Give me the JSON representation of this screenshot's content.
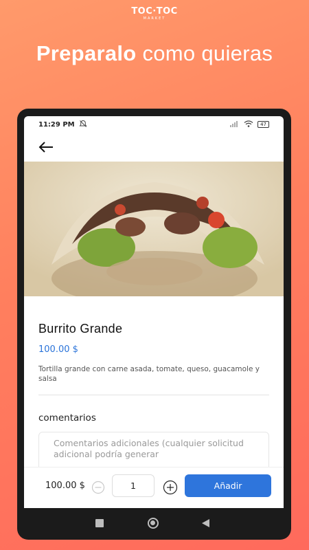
{
  "brand": {
    "name": "TOC·TOC",
    "sub": "MARKET"
  },
  "headline": {
    "bold": "Preparalo",
    "rest": "como quieras"
  },
  "status": {
    "time": "11:29 PM",
    "battery": "47"
  },
  "product": {
    "title": "Burrito Grande",
    "price": "100.00 $",
    "description": "Tortilla grande con carne asada, tomate, queso, guacamole y salsa"
  },
  "comments": {
    "label": "comentarios",
    "placeholder": "Comentarios adicionales (cualquier solicitud adicional podría generar"
  },
  "cart": {
    "total": "100.00 $",
    "quantity": "1",
    "add_label": "Añadir"
  }
}
